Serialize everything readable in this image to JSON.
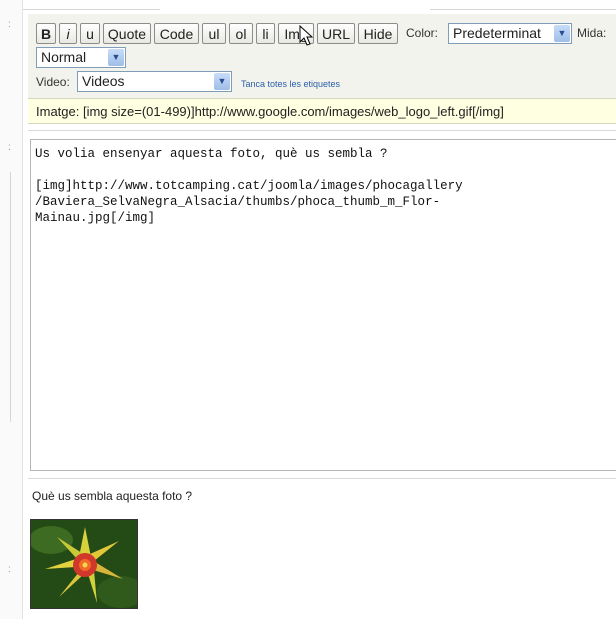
{
  "toolbar": {
    "buttons": [
      "B",
      "i",
      "u",
      "Quote",
      "Code",
      "ul",
      "ol",
      "li",
      "Img",
      "URL",
      "Hide"
    ],
    "color_label": "Color:",
    "color_value": "Predeterminat",
    "size_label": "Mida:",
    "size_value": "Normal",
    "video_label": "Video:",
    "video_value": "Videos",
    "close_tags_link": "Tanca totes les etiquetes"
  },
  "hint": {
    "text": "Imatge: [img size=(01-499)]http://www.google.com/images/web_logo_left.gif[/img]"
  },
  "editor": {
    "text": "Us volia ensenyar aquesta foto, què us sembla ?\n\n[img]http://www.totcamping.cat/joomla/images/phocagallery\n/Baviera_SelvaNegra_Alsacia/thumbs/phoca_thumb_m_Flor-\nMainau.jpg[/img]"
  },
  "preview": {
    "text": "Què us sembla aquesta foto ?",
    "image_icon": "flower-photo"
  },
  "colors": {
    "toolbar_bg": "#f3f3ee",
    "hint_bg": "#ffffe1",
    "link": "#2b5fa8"
  }
}
